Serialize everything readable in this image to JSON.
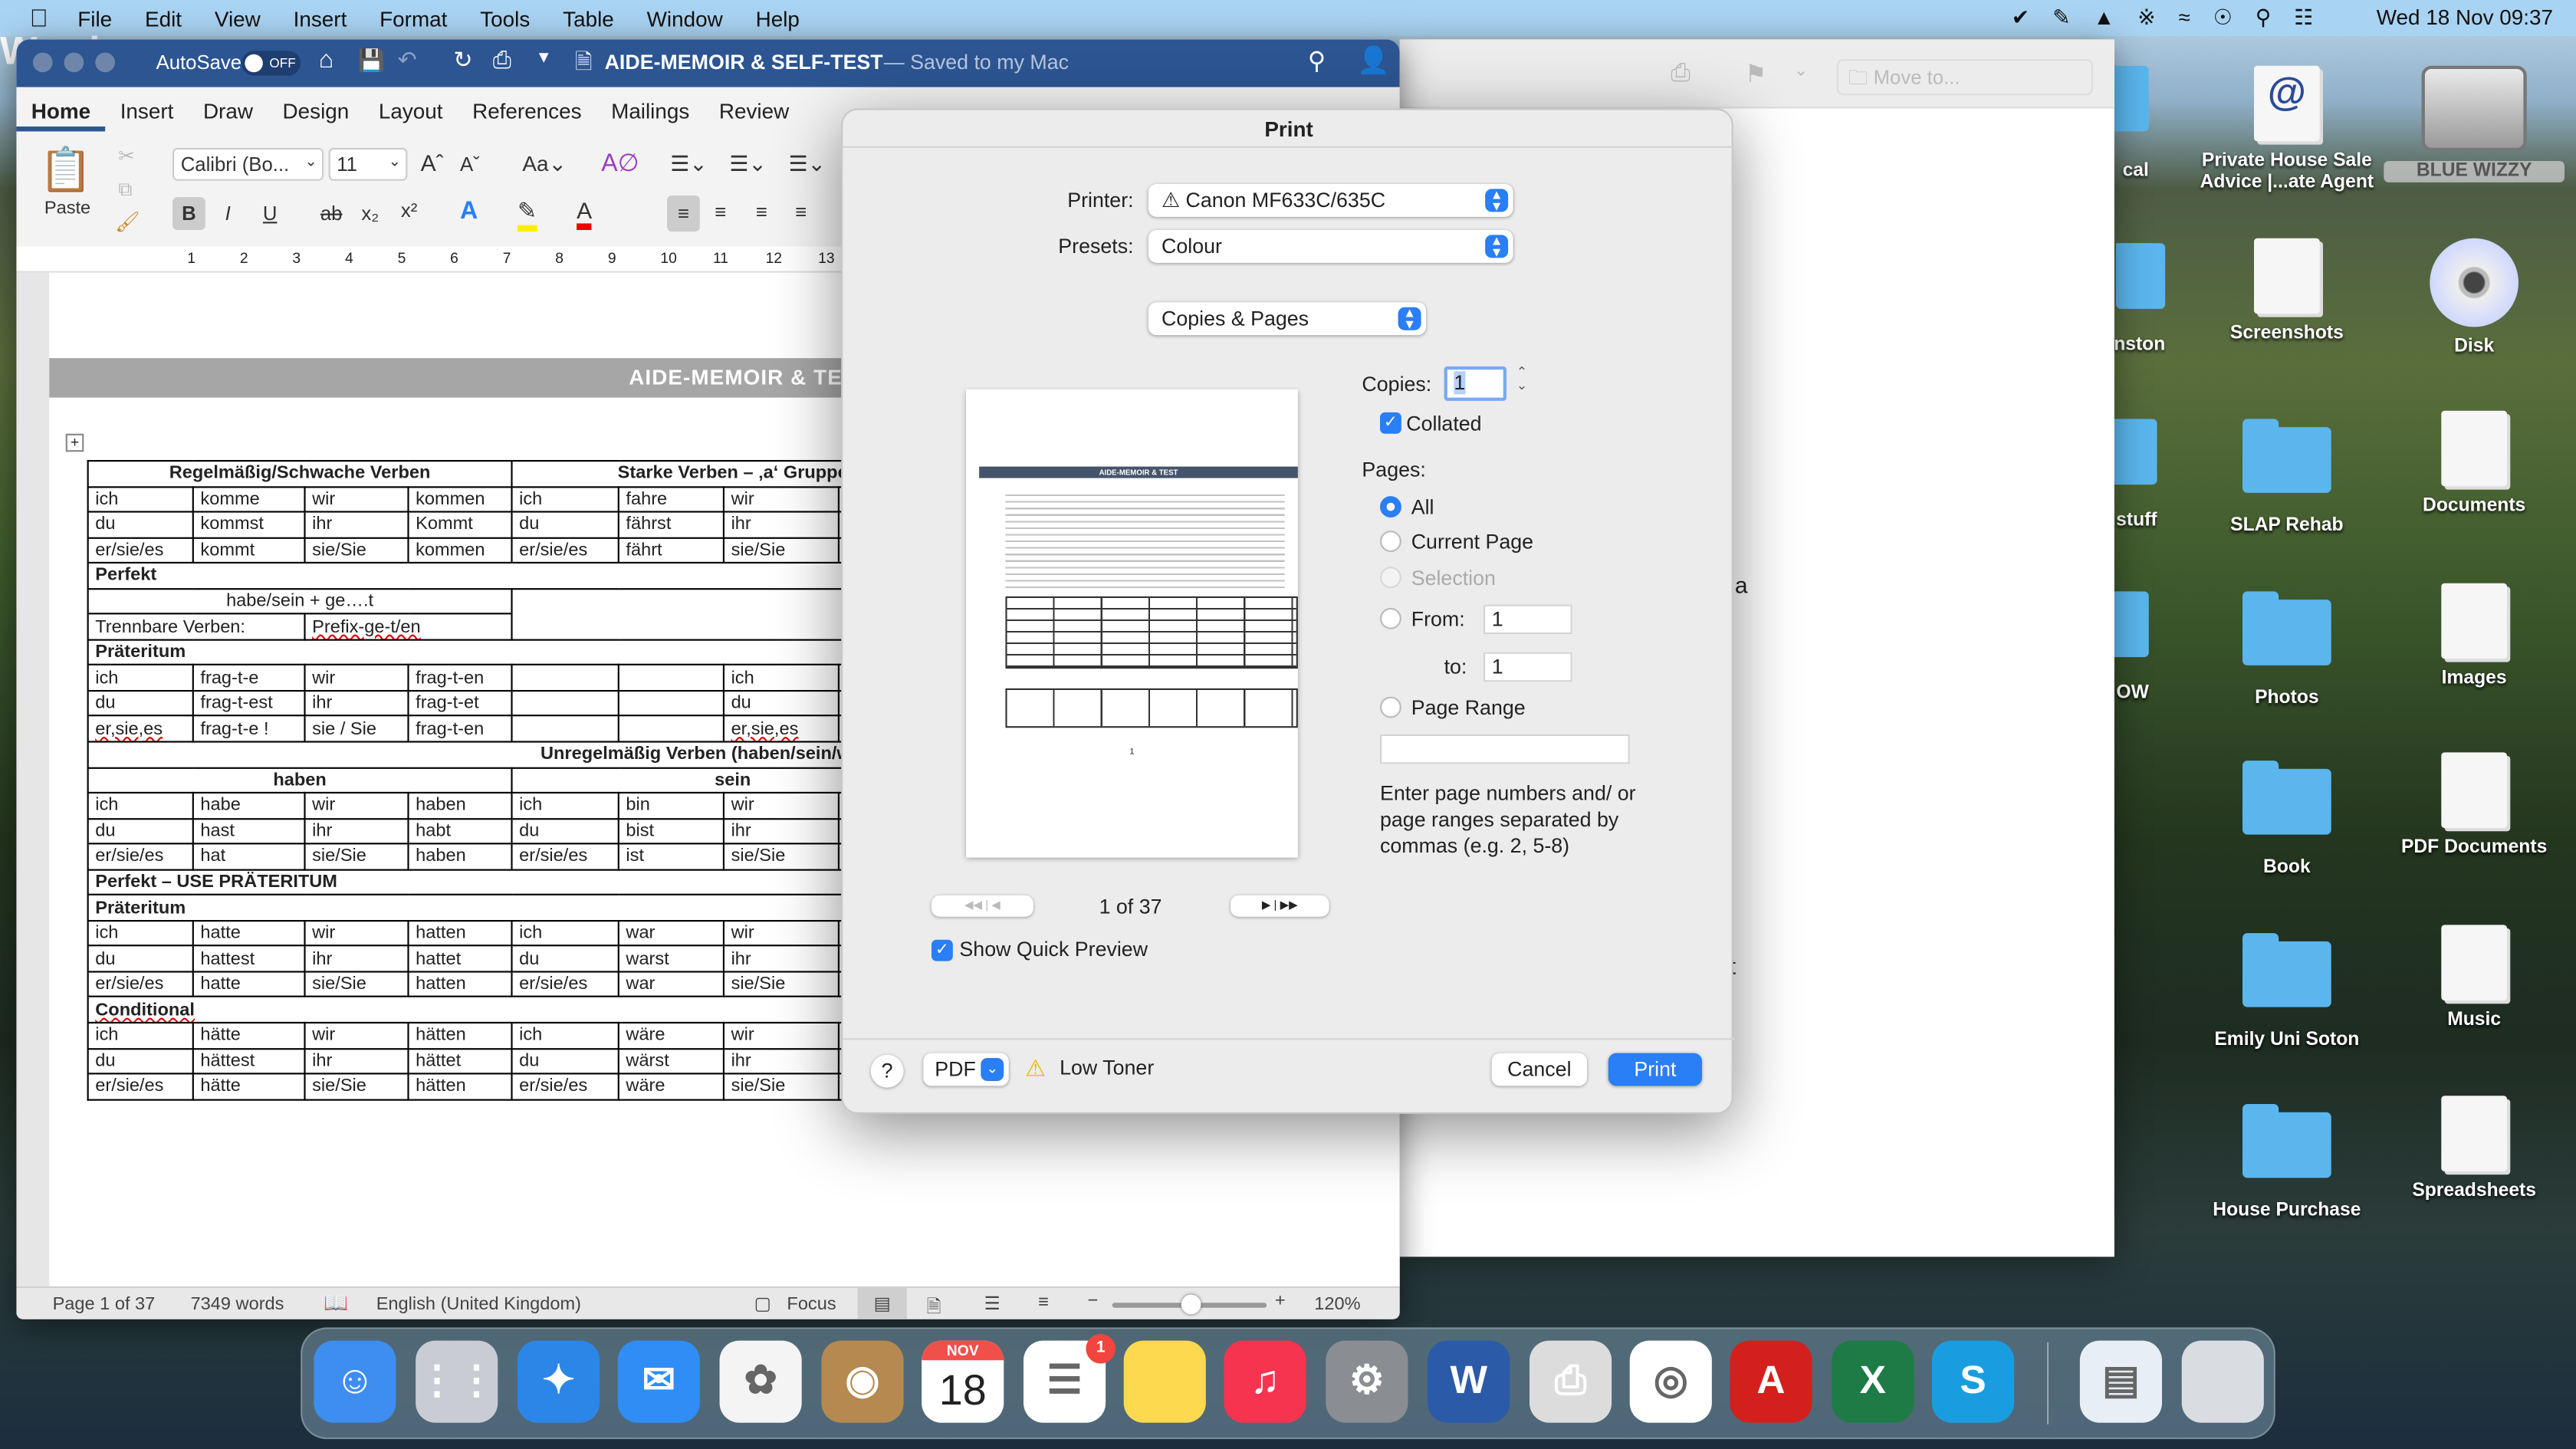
{
  "menubar": {
    "app": "Word",
    "items": [
      "File",
      "Edit",
      "View",
      "Insert",
      "Format",
      "Tools",
      "Table",
      "Window",
      "Help"
    ],
    "clock": "Wed 18 Nov  09:37",
    "bg_color": "#a9d3f2"
  },
  "word": {
    "autosave": "AutoSave",
    "autosave_state": "OFF",
    "doc_title": "AIDE-MEMOIR & SELF-TEST",
    "saved": "— Saved to my Mac",
    "title_color": "#2c5592",
    "tabs": [
      "Home",
      "Insert",
      "Draw",
      "Design",
      "Layout",
      "References",
      "Mailings",
      "Review"
    ],
    "active_tab": "Home",
    "paste": "Paste",
    "font": "Calibri (Bo...",
    "size": "11",
    "ruler": [
      "1",
      "2",
      "3",
      "4",
      "5",
      "6",
      "7",
      "8",
      "9",
      "10",
      "11",
      "12",
      "13",
      "14"
    ],
    "header_band": "AIDE-MEMOIR & TES",
    "status": {
      "page": "Page 1 of 37",
      "words": "7349 words",
      "language": "English (United Kingdom)",
      "focus": "Focus",
      "zoom": "120%"
    }
  },
  "table": {
    "rows": [
      [
        {
          "t": "Regelmäßig/Schwache Verben",
          "s": 4,
          "c": "b c"
        },
        {
          "t": "Starke Verben – ‚a‘ Gruppe",
          "s": 4,
          "c": "b c"
        }
      ],
      [
        "ich",
        "komme",
        "wir",
        "kommen",
        "ich",
        "fahre",
        "wir",
        ""
      ],
      [
        "du",
        "kommst",
        "ihr",
        "Kommt",
        "du",
        "fährst",
        "ihr",
        ""
      ],
      [
        "er/sie/es",
        "kommt",
        "sie/Sie",
        "kommen",
        "er/sie/es",
        "fährt",
        "sie/Sie",
        ""
      ],
      [
        {
          "t": "Perfekt",
          "s": 8,
          "c": "b"
        }
      ],
      [
        {
          "t": "habe/sein + ge….t",
          "s": 4,
          "c": "c"
        },
        {
          "t": "",
          "s": 4,
          "r": 2
        }
      ],
      [
        {
          "t": "Trennbare Verben:",
          "s": 2
        },
        {
          "t": "Prefix-ge-t/en",
          "s": 2,
          "c": "sp"
        }
      ],
      [
        {
          "t": "Präteritum",
          "s": 8,
          "c": "b"
        }
      ],
      [
        "ich",
        "frag-t-e",
        "wir",
        "frag-t-en",
        "",
        "",
        "ich",
        ""
      ],
      [
        "du",
        "frag-t-est",
        "ihr",
        "frag-t-et",
        "",
        "",
        "du",
        ""
      ],
      [
        {
          "t": "er,sie,es",
          "c": "sp"
        },
        "frag-t-e !",
        "sie / Sie",
        "frag-t-en",
        "",
        "",
        {
          "t": "er,sie,es",
          "c": "sp"
        },
        ""
      ],
      [
        {
          "t": "Unregelmäßig Verben (haben/sein/werden)",
          "s": 8,
          "c": "u"
        }
      ],
      [
        {
          "t": "haben",
          "s": 4,
          "c": "b c"
        },
        {
          "t": "sein",
          "s": 4,
          "c": "b c"
        }
      ],
      [
        "ich",
        "habe",
        "wir",
        "haben",
        "ich",
        "bin",
        "wir",
        ""
      ],
      [
        "du",
        "hast",
        "ihr",
        "habt",
        "du",
        "bist",
        "ihr",
        ""
      ],
      [
        "er/sie/es",
        "hat",
        "sie/Sie",
        "haben",
        "er/sie/es",
        "ist",
        "sie/Sie",
        ""
      ],
      [
        {
          "t": "Perfekt – USE PRÄTERITUM",
          "s": 8,
          "c": "b"
        }
      ],
      [
        {
          "t": "Präteritum",
          "s": 8,
          "c": "b"
        }
      ],
      [
        "ich",
        "hatte",
        "wir",
        "hatten",
        "ich",
        "war",
        "wir",
        ""
      ],
      [
        "du",
        "hattest",
        "ihr",
        "hattet",
        "du",
        "warst",
        "ihr",
        ""
      ],
      [
        "er/sie/es",
        "hatte",
        "sie/Sie",
        "hatten",
        "er/sie/es",
        "war",
        "sie/Sie",
        ""
      ],
      [
        {
          "t": "Conditional",
          "s": 8,
          "c": "b sp"
        }
      ],
      [
        "ich",
        "hätte",
        "wir",
        "hätten",
        "ich",
        "wäre",
        "wir",
        ""
      ],
      [
        "du",
        "hättest",
        "ihr",
        "hättet",
        "du",
        "wärst",
        "ihr",
        ""
      ],
      [
        "er/sie/es",
        "hätte",
        "sie/Sie",
        "hätten",
        "er/sie/es",
        "wäre",
        "sie/Sie",
        ""
      ]
    ]
  },
  "print": {
    "title": "Print",
    "printer_label": "Printer:",
    "printer": "Canon MF633C/635C",
    "presets_label": "Presets:",
    "presets": "Colour",
    "section": "Copies & Pages",
    "copies_label": "Copies:",
    "copies": "1",
    "collated": "Collated",
    "collated_checked": true,
    "pages_label": "Pages:",
    "options": [
      "All",
      "Current Page",
      "Selection"
    ],
    "selected": "All",
    "from_label": "From:",
    "from": "1",
    "to_label": "to:",
    "to": "1",
    "page_range": "Page Range",
    "hint": "Enter page numbers and/ or page ranges separated by commas (e.g. 2, 5-8)",
    "preview_title": "AIDE-MEMOIR & TEST",
    "preview_page_no": "1",
    "page_indicator": "1 of 37",
    "show_preview": "Show Quick Preview",
    "show_preview_checked": true,
    "help": "?",
    "pdf": "PDF",
    "low_toner": "Low Toner",
    "cancel": "Cancel",
    "print": "Print",
    "accent": "#2a7ef6"
  },
  "bg_window": {
    "move_to": "Move to...",
    "frag1": "a",
    "frag2": "rt"
  },
  "desktop": {
    "partial": [
      "cal",
      "nston",
      "stuff",
      "OW"
    ],
    "col1": [
      "Private House Sale Advice |...ate Agent",
      "Screenshots",
      "SLAP Rehab",
      "Photos",
      "Book",
      "Emily Uni Soton",
      "House Purchase"
    ],
    "col2": [
      "BLUE WIZZY",
      "Disk",
      "Documents",
      "Images",
      "PDF Documents",
      "Music",
      "Spreadsheets"
    ]
  },
  "dock": {
    "apps": [
      "Finder",
      "Launchpad",
      "Safari",
      "Mail",
      "Photos",
      "Contacts",
      "Calendar",
      "Reminders",
      "Notes",
      "Music",
      "System Preferences",
      "Word",
      "Printer",
      "Chrome",
      "Acrobat",
      "Excel",
      "Skype",
      "Document",
      "Trash"
    ],
    "calendar_month": "NOV",
    "calendar_day": "18",
    "reminders_badge": "1"
  }
}
